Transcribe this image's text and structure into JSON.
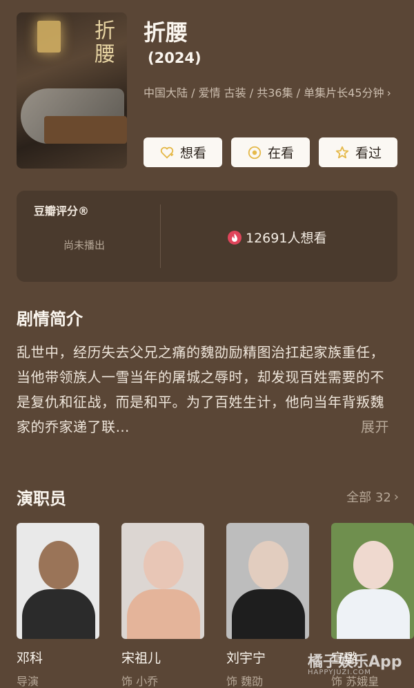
{
  "movie": {
    "title": "折腰",
    "year": "(2024)",
    "meta_line": "中国大陆 / 爱情 古装 / 共36集 / 单集片长45分钟",
    "poster_title": "折腰"
  },
  "actions": [
    {
      "label": "想看",
      "icon": "heart-plus-icon"
    },
    {
      "label": "在看",
      "icon": "target-icon"
    },
    {
      "label": "看过",
      "icon": "star-icon"
    }
  ],
  "rating": {
    "label": "豆瓣评分®",
    "status": "尚未播出",
    "want_count": "12691人想看"
  },
  "synopsis": {
    "heading": "剧情简介",
    "text": "乱世中，经历失去父兄之痛的魏劭励精图治扛起家族重任，当他带领族人一雪当年的屠城之辱时，却发现百姓需要的不是复仇和征战，而是和平。为了百姓生计，他向当年背叛魏家的乔家递了联…",
    "expand": "展开"
  },
  "cast_section": {
    "heading": "演职员",
    "all_label": "全部 32",
    "members": [
      {
        "name": "邓科",
        "role": "导演"
      },
      {
        "name": "宋祖儿",
        "role": "饰 小乔"
      },
      {
        "name": "刘宇宁",
        "role": "饰 魏劭"
      },
      {
        "name": "宣璐",
        "role": "饰 苏娥皇"
      }
    ]
  },
  "watermark": {
    "text": "橘子娱乐App",
    "sub": "HAPPYJUZI.COM"
  },
  "colors": {
    "background": "#5a4636",
    "card": "#4a3a2d",
    "accent": "#e5b94a",
    "fire": "#e0455b"
  }
}
